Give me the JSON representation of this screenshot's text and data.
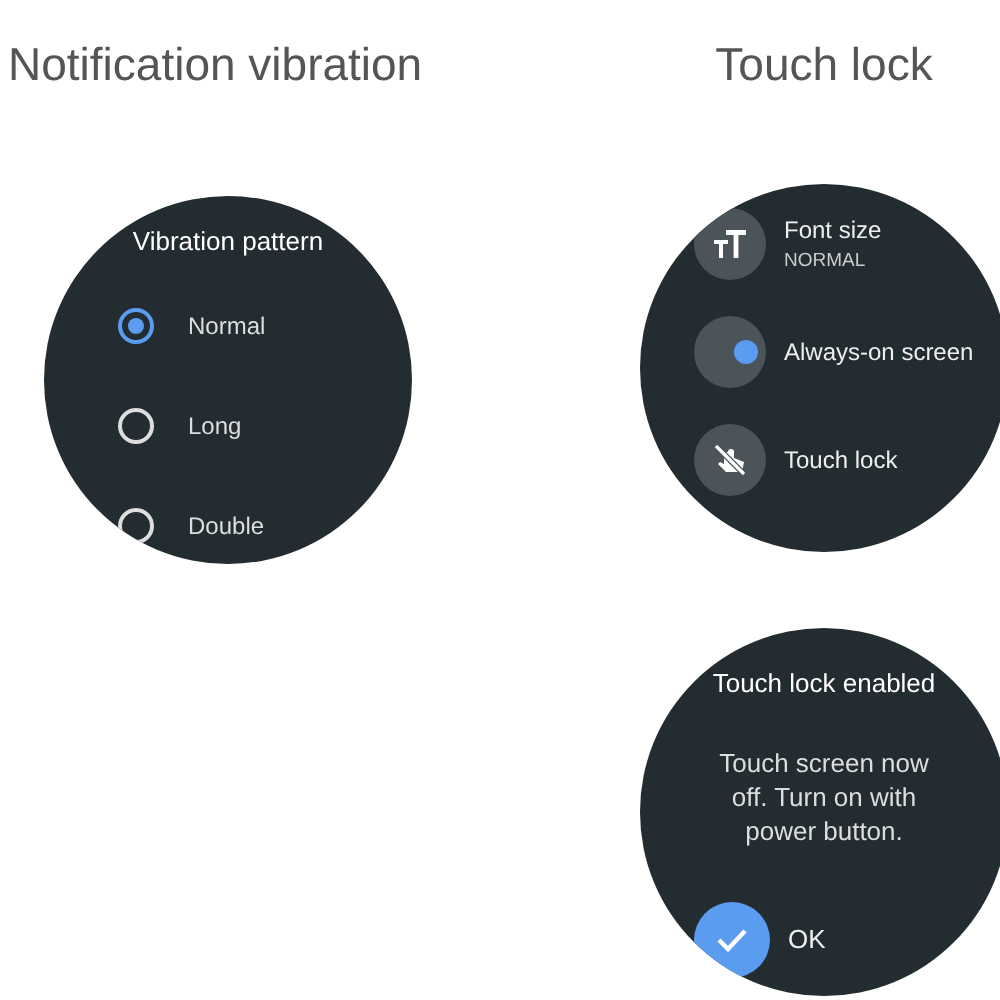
{
  "panels": [
    {
      "title": "Notification vibration",
      "screens": [
        {
          "kind": "radio_list",
          "heading": "Vibration pattern",
          "options": [
            {
              "label": "Normal",
              "selected": true
            },
            {
              "label": "Long",
              "selected": false
            },
            {
              "label": "Double",
              "selected": false
            }
          ]
        }
      ]
    },
    {
      "title": "Touch lock",
      "screens": [
        {
          "kind": "menu",
          "items": [
            {
              "kind": "text_size",
              "label": "Font size",
              "value": "NORMAL"
            },
            {
              "kind": "toggle",
              "label": "Always-on screen",
              "on": true
            },
            {
              "kind": "touch_lock",
              "label": "Touch lock"
            }
          ]
        },
        {
          "kind": "dialog",
          "heading": "Touch lock enabled",
          "message": "Touch screen now off. Turn on with power button.",
          "button": "OK"
        }
      ]
    }
  ]
}
